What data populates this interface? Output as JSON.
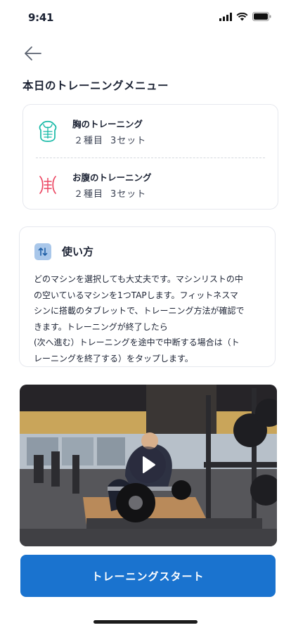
{
  "status_bar": {
    "time": "9:41"
  },
  "page": {
    "title": "本日のトレーニングメニュー"
  },
  "menu": {
    "items": [
      {
        "name": "胸のトレーニング",
        "types": "２種目",
        "sets": "3セット",
        "icon": "chest-icon",
        "color": "#16b9a6"
      },
      {
        "name": "お腹のトレーニング",
        "types": "２種目",
        "sets": "3セット",
        "icon": "abs-icon",
        "color": "#ec4763"
      }
    ]
  },
  "howto": {
    "heading": "使い方",
    "icon": "swap-arrows-icon",
    "lines": [
      "どのマシンを選択しても大丈夫です。マシンリストの中",
      "の空いているマシンを1つTAPします。フィットネスマ",
      "シンに搭載のタブレットで、トレーニング方法が確認で",
      "きます。トレーニングが終了したら",
      "(次へ進む）トレーニングを途中で中断する場合は（ト",
      "レーニングを終了する）をタップします。"
    ]
  },
  "video": {
    "icon": "play-icon"
  },
  "cta": {
    "label": "トレーニングスタート",
    "color": "#1a73cf"
  }
}
